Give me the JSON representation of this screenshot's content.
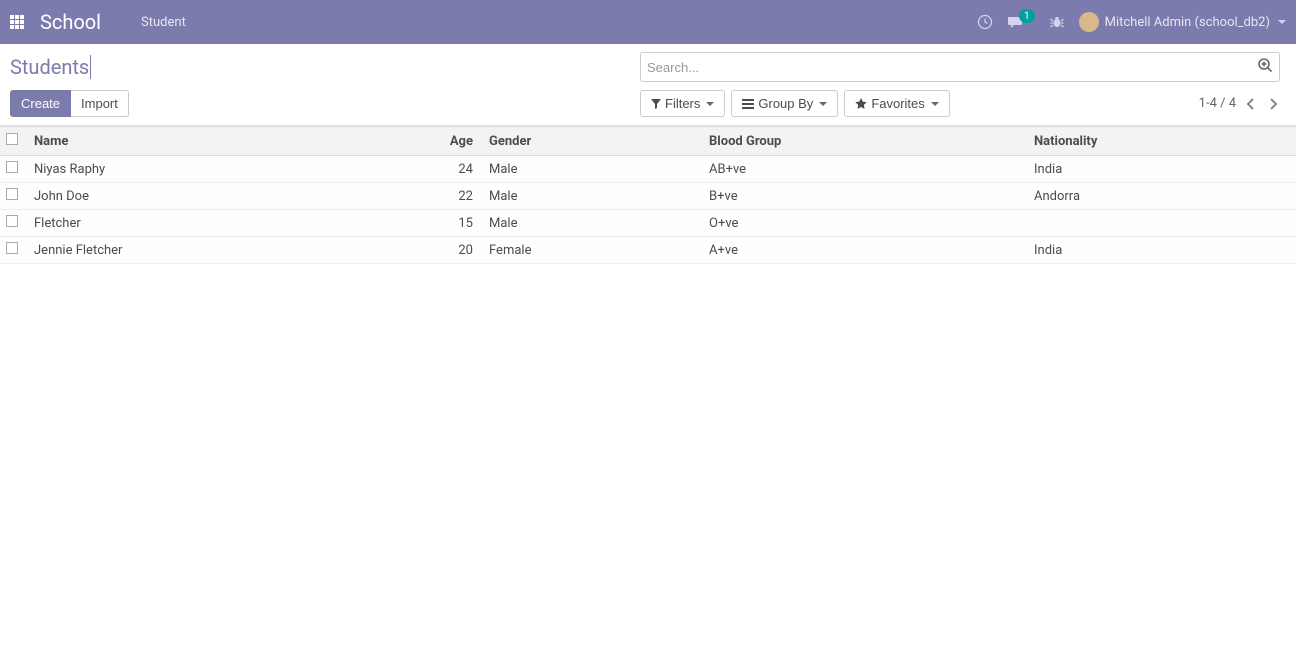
{
  "navbar": {
    "app_title": "School",
    "menu_item": "Student",
    "msg_count": "1",
    "user_label": "Mitchell Admin (school_db2)"
  },
  "control": {
    "breadcrumb": "Students",
    "search_placeholder": "Search...",
    "create_label": "Create",
    "import_label": "Import",
    "filters_label": "Filters",
    "groupby_label": "Group By",
    "favorites_label": "Favorites",
    "pager_text": "1-4 / 4"
  },
  "table": {
    "columns": {
      "name": "Name",
      "age": "Age",
      "gender": "Gender",
      "blood": "Blood Group",
      "nat": "Nationality"
    },
    "rows": [
      {
        "name": "Niyas Raphy",
        "age": "24",
        "gender": "Male",
        "blood": "AB+ve",
        "nat": "India"
      },
      {
        "name": "John Doe",
        "age": "22",
        "gender": "Male",
        "blood": "B+ve",
        "nat": "Andorra"
      },
      {
        "name": "Fletcher",
        "age": "15",
        "gender": "Male",
        "blood": "O+ve",
        "nat": ""
      },
      {
        "name": "Jennie Fletcher",
        "age": "20",
        "gender": "Female",
        "blood": "A+ve",
        "nat": "India"
      }
    ]
  }
}
